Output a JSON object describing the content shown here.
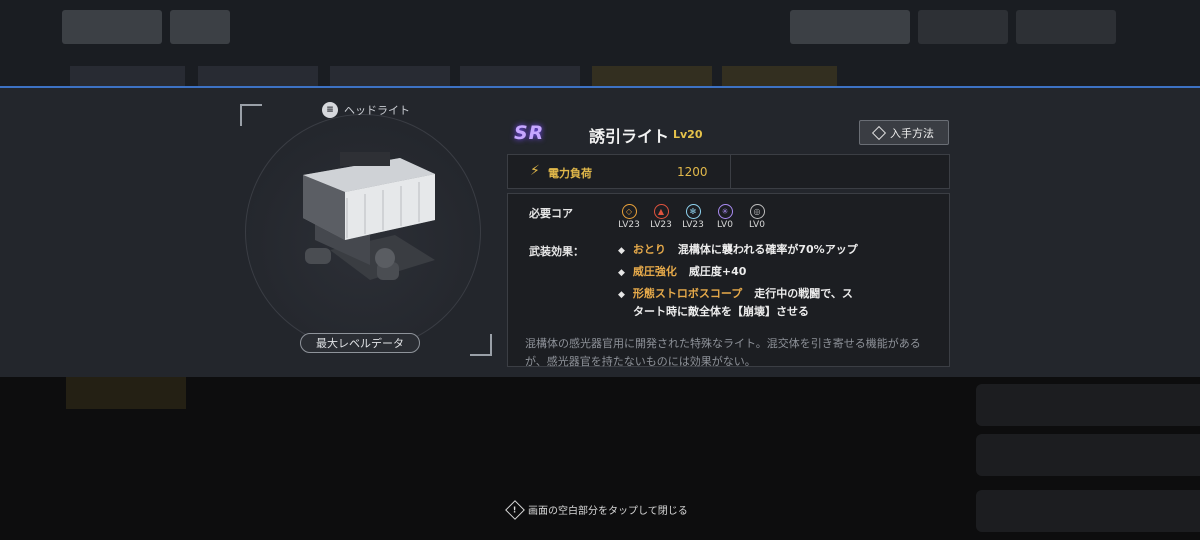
{
  "item": {
    "category": "ヘッドライト",
    "rarity": "SR",
    "name": "誘引ライト",
    "level": "Lv20",
    "max_level_button": "最大レベルデータ",
    "obtain_button": "入手方法"
  },
  "power": {
    "label": "電力負荷",
    "value": "1200"
  },
  "cores": {
    "label": "必要コア",
    "list": [
      {
        "icon": "swirl-core-icon",
        "color": "#e8a13a",
        "level": "LV23"
      },
      {
        "icon": "flame-core-icon",
        "color": "#e0533e",
        "level": "LV23"
      },
      {
        "icon": "snowflake-core-icon",
        "color": "#8fd3f0",
        "level": "LV23"
      },
      {
        "icon": "spark-core-icon",
        "color": "#a98bf2",
        "level": "LV0"
      },
      {
        "icon": "ring-core-icon",
        "color": "#bdbdbd",
        "level": "LV0"
      }
    ]
  },
  "armament": {
    "label": "武装効果：",
    "effects": [
      {
        "name": "おとり",
        "text": "混構体に襲われる確率が70%アップ"
      },
      {
        "name": "威圧強化",
        "text": "威圧度+40"
      },
      {
        "name": "形態ストロボスコープ",
        "text": "走行中の戦闘で、ス",
        "text2": "タート時に敵全体を【崩壊】させる"
      }
    ]
  },
  "description": "混構体の感光器官用に開発された特殊なライト。混交体を引き寄せる機能があるが、感光器官を持たないものには効果がない。",
  "close_hint": "画面の空白部分をタップして閉じる",
  "colors": {
    "accent_blue": "#3d72c4",
    "gold": "#e1b84a",
    "effect_orange": "#e5a94a",
    "rarity_purple": "#c6a6ff"
  }
}
